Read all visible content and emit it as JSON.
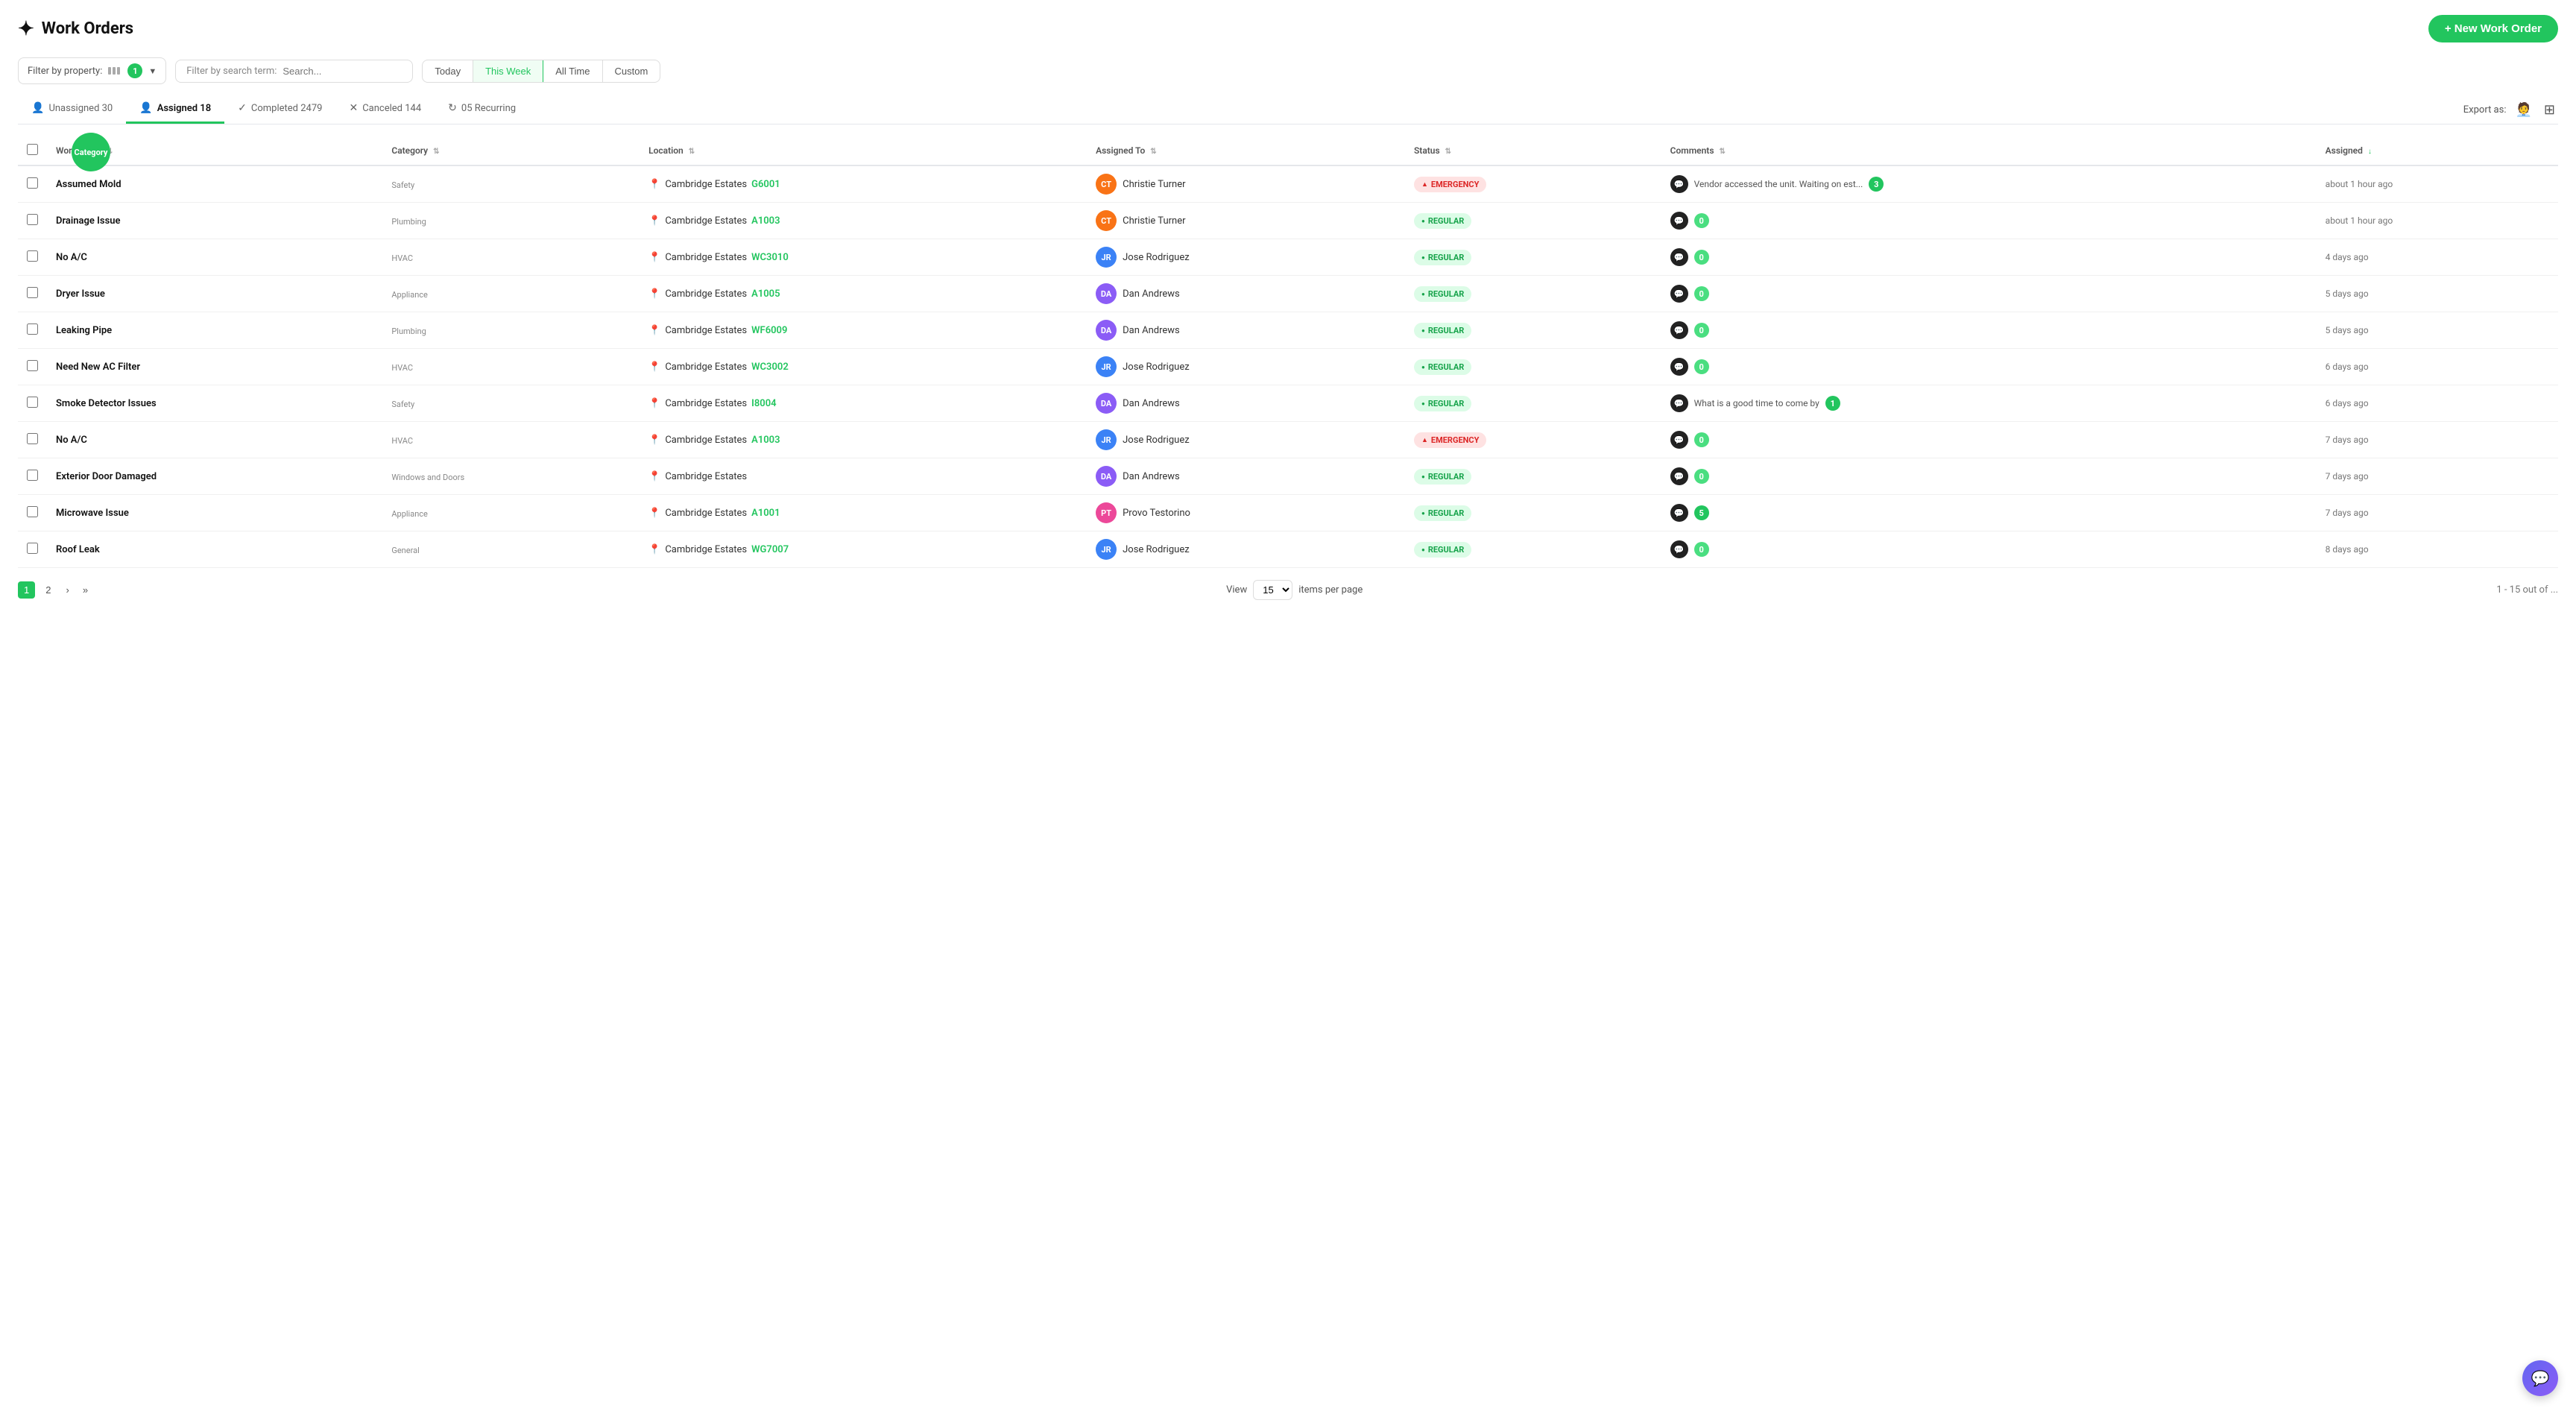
{
  "header": {
    "logo": "✦",
    "title": "Work Orders",
    "new_button": "+ New Work Order"
  },
  "filters": {
    "property_label": "Filter by property:",
    "property_badge": "1",
    "search_label": "Filter by search term:",
    "search_placeholder": "Search..."
  },
  "date_filters": [
    {
      "id": "today",
      "label": "Today",
      "active": false
    },
    {
      "id": "this_week",
      "label": "This Week",
      "active": true
    },
    {
      "id": "all_time",
      "label": "All Time",
      "active": false
    },
    {
      "id": "custom",
      "label": "Custom",
      "active": false
    }
  ],
  "status_tabs": [
    {
      "id": "unassigned",
      "label": "Unassigned 30",
      "icon": "👤",
      "active": false
    },
    {
      "id": "assigned",
      "label": "Assigned 18",
      "icon": "👤",
      "active": true
    },
    {
      "id": "completed",
      "label": "Completed 2479",
      "icon": "✓",
      "active": false
    },
    {
      "id": "canceled",
      "label": "Canceled 144",
      "icon": "✕",
      "active": false
    },
    {
      "id": "recurring",
      "label": "05 Recurring",
      "icon": "↻",
      "active": false
    }
  ],
  "export_label": "Export as:",
  "table": {
    "columns": [
      {
        "id": "work_order",
        "label": "Work Order",
        "sortable": true,
        "active": false
      },
      {
        "id": "category",
        "label": "Category",
        "sortable": true,
        "active": false
      },
      {
        "id": "location",
        "label": "Location",
        "sortable": true,
        "active": false
      },
      {
        "id": "assigned_to",
        "label": "Assigned To",
        "sortable": true,
        "active": false
      },
      {
        "id": "status",
        "label": "Status",
        "sortable": true,
        "active": false
      },
      {
        "id": "comments",
        "label": "Comments",
        "sortable": true,
        "active": false
      },
      {
        "id": "assigned",
        "label": "Assigned",
        "sortable": true,
        "active": true
      }
    ],
    "rows": [
      {
        "id": 1,
        "work_order": "Assumed Mold",
        "category": "Safety",
        "location_name": "Cambridge Estates",
        "location_unit": "G6001",
        "assigned_to": "Christie Turner",
        "avatar_bg": "#f97316",
        "avatar_initials": "CT",
        "status": "EMERGENCY",
        "status_type": "emergency",
        "comment_text": "Vendor accessed the unit. Waiting on est...",
        "comment_count": 3,
        "comment_count_zero": false,
        "assigned_time": "about 1 hour ago"
      },
      {
        "id": 2,
        "work_order": "Drainage Issue",
        "category": "Plumbing",
        "location_name": "Cambridge Estates",
        "location_unit": "A1003",
        "assigned_to": "Christie Turner",
        "avatar_bg": "#f97316",
        "avatar_initials": "CT",
        "status": "REGULAR",
        "status_type": "regular",
        "comment_text": "",
        "comment_count": 0,
        "comment_count_zero": true,
        "assigned_time": "about 1 hour ago"
      },
      {
        "id": 3,
        "work_order": "No A/C",
        "category": "HVAC",
        "location_name": "Cambridge Estates",
        "location_unit": "WC3010",
        "assigned_to": "Jose Rodriguez",
        "avatar_bg": "#3b82f6",
        "avatar_initials": "JR",
        "status": "REGULAR",
        "status_type": "regular",
        "comment_text": "",
        "comment_count": 0,
        "comment_count_zero": true,
        "assigned_time": "4 days ago"
      },
      {
        "id": 4,
        "work_order": "Dryer Issue",
        "category": "Appliance",
        "location_name": "Cambridge Estates",
        "location_unit": "A1005",
        "assigned_to": "Dan Andrews",
        "avatar_bg": "#8b5cf6",
        "avatar_initials": "DA",
        "status": "REGULAR",
        "status_type": "regular",
        "comment_text": "",
        "comment_count": 0,
        "comment_count_zero": true,
        "assigned_time": "5 days ago"
      },
      {
        "id": 5,
        "work_order": "Leaking Pipe",
        "category": "Plumbing",
        "location_name": "Cambridge Estates",
        "location_unit": "WF6009",
        "assigned_to": "Dan Andrews",
        "avatar_bg": "#8b5cf6",
        "avatar_initials": "DA",
        "status": "REGULAR",
        "status_type": "regular",
        "comment_text": "",
        "comment_count": 0,
        "comment_count_zero": true,
        "assigned_time": "5 days ago"
      },
      {
        "id": 6,
        "work_order": "Need New AC Filter",
        "category": "HVAC",
        "location_name": "Cambridge Estates",
        "location_unit": "WC3002",
        "assigned_to": "Jose Rodriguez",
        "avatar_bg": "#3b82f6",
        "avatar_initials": "JR",
        "status": "REGULAR",
        "status_type": "regular",
        "comment_text": "",
        "comment_count": 0,
        "comment_count_zero": true,
        "assigned_time": "6 days ago"
      },
      {
        "id": 7,
        "work_order": "Smoke Detector Issues",
        "category": "Safety",
        "location_name": "Cambridge Estates",
        "location_unit": "I8004",
        "assigned_to": "Dan Andrews",
        "avatar_bg": "#8b5cf6",
        "avatar_initials": "DA",
        "status": "REGULAR",
        "status_type": "regular",
        "comment_text": "What is a good time to come by",
        "comment_count": 1,
        "comment_count_zero": false,
        "assigned_time": "6 days ago"
      },
      {
        "id": 8,
        "work_order": "No A/C",
        "category": "HVAC",
        "location_name": "Cambridge Estates",
        "location_unit": "A1003",
        "assigned_to": "Jose Rodriguez",
        "avatar_bg": "#3b82f6",
        "avatar_initials": "JR",
        "status": "EMERGENCY",
        "status_type": "emergency",
        "comment_text": "",
        "comment_count": 0,
        "comment_count_zero": true,
        "assigned_time": "7 days ago"
      },
      {
        "id": 9,
        "work_order": "Exterior Door Damaged",
        "category": "Windows and Doors",
        "location_name": "Cambridge Estates",
        "location_unit": "",
        "assigned_to": "Dan Andrews",
        "avatar_bg": "#8b5cf6",
        "avatar_initials": "DA",
        "status": "REGULAR",
        "status_type": "regular",
        "comment_text": "",
        "comment_count": 0,
        "comment_count_zero": true,
        "assigned_time": "7 days ago"
      },
      {
        "id": 10,
        "work_order": "Microwave Issue",
        "category": "Appliance",
        "location_name": "Cambridge Estates",
        "location_unit": "A1001",
        "assigned_to": "Provo Testorino",
        "avatar_bg": "#ec4899",
        "avatar_initials": "PT",
        "status": "REGULAR",
        "status_type": "regular",
        "comment_text": "",
        "comment_count": 5,
        "comment_count_zero": false,
        "assigned_time": "7 days ago"
      },
      {
        "id": 11,
        "work_order": "Roof Leak",
        "category": "General",
        "location_name": "Cambridge Estates",
        "location_unit": "WG7007",
        "assigned_to": "Jose Rodriguez",
        "avatar_bg": "#3b82f6",
        "avatar_initials": "JR",
        "status": "REGULAR",
        "status_type": "regular",
        "comment_text": "",
        "comment_count": 0,
        "comment_count_zero": true,
        "assigned_time": "8 days ago"
      }
    ]
  },
  "pagination": {
    "current_page": 1,
    "pages": [
      "1",
      "2"
    ],
    "view_label": "View",
    "items_per_page": "15",
    "per_page_label": "items per page",
    "range_label": "1 - 15 out of"
  },
  "category_overlay": "Category"
}
